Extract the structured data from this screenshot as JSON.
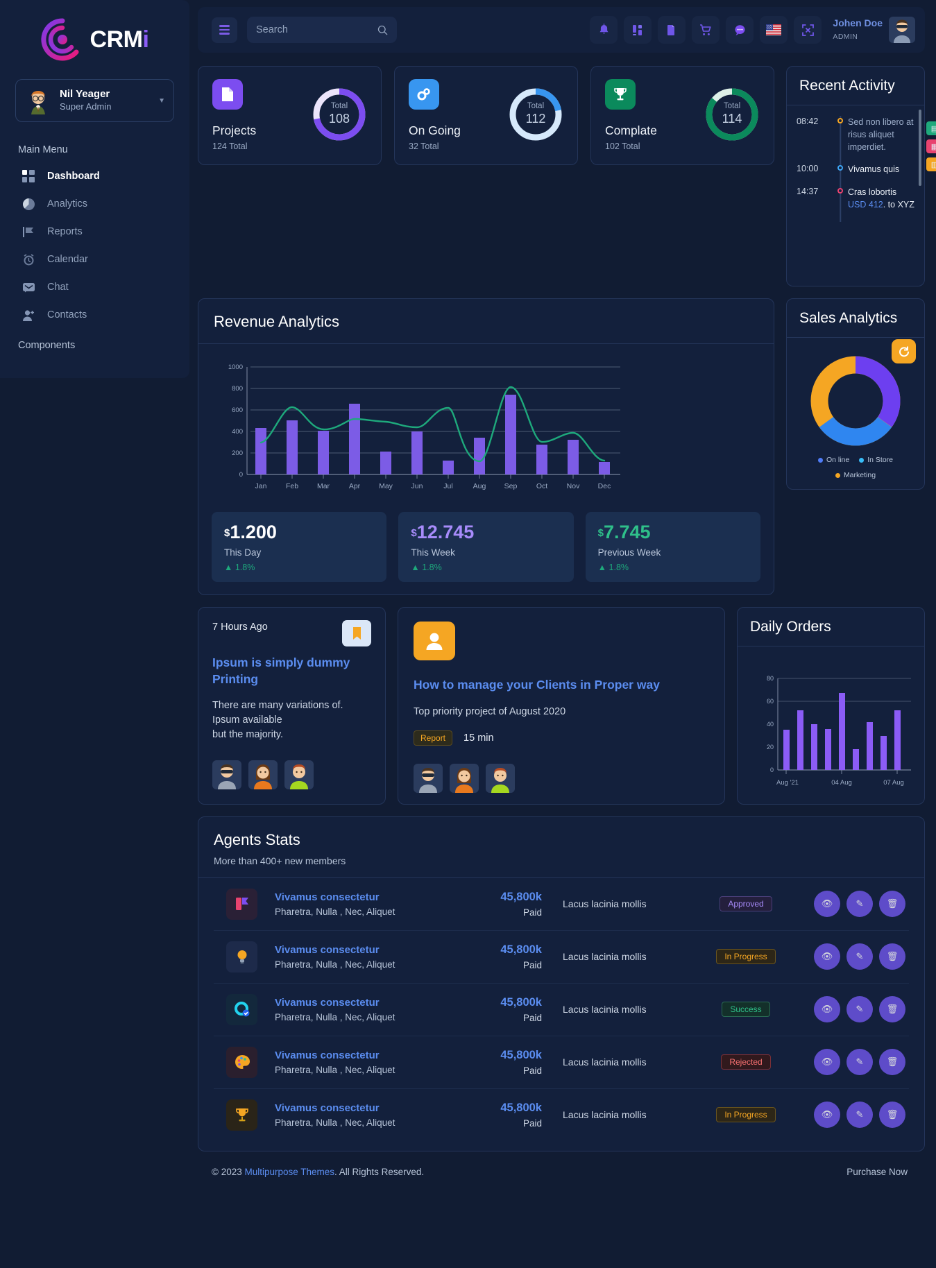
{
  "brand": {
    "name": "CRM",
    "accent_letter": "i",
    "logo_icon": "crm-spiral-logo"
  },
  "sidebar": {
    "profile": {
      "name": "Nil Yeager",
      "role": "Super Admin",
      "avatar_icon": "avatar-nil-yeager",
      "caret_icon": "chevron-down-icon"
    },
    "section_main": "Main Menu",
    "section_components": "Components",
    "items": [
      {
        "label": "Dashboard",
        "icon": "grid-icon",
        "active": true
      },
      {
        "label": "Analytics",
        "icon": "pie-chart-icon",
        "active": false
      },
      {
        "label": "Reports",
        "icon": "flag-icon",
        "active": false
      },
      {
        "label": "Calendar",
        "icon": "alarm-clock-icon",
        "active": false
      },
      {
        "label": "Chat",
        "icon": "chat-bubble-icon",
        "active": false
      },
      {
        "label": "Contacts",
        "icon": "user-plus-icon",
        "active": false
      }
    ]
  },
  "topbar": {
    "menu_toggle_icon": "hamburger-icon",
    "search": {
      "placeholder": "Search",
      "value": "",
      "icon": "search-icon"
    },
    "icons": [
      {
        "name": "bell-icon"
      },
      {
        "name": "widgets-icon"
      },
      {
        "name": "folder-icon"
      },
      {
        "name": "cart-icon"
      },
      {
        "name": "message-icon"
      },
      {
        "name": "flag-us-icon"
      },
      {
        "name": "fullscreen-icon"
      }
    ],
    "user": {
      "name": "Johen Doe",
      "role": "ADMIN",
      "avatar_icon": "avatar-johen-doe"
    }
  },
  "stat_cards": [
    {
      "title": "Projects",
      "subtitle": "124 Total",
      "total_label": "Total",
      "total_value": "108",
      "icon": "file-icon",
      "color": "#7c4df0",
      "track": "#ece5fb",
      "percent": 72
    },
    {
      "title": "On Going",
      "subtitle": "32 Total",
      "total_label": "Total",
      "total_value": "112",
      "icon": "gears-icon",
      "color": "#3896f0",
      "track": "#d6e9fb",
      "percent": 22
    },
    {
      "title": "Complate",
      "subtitle": "102 Total",
      "total_label": "Total",
      "total_value": "114",
      "icon": "trophy-icon",
      "color": "#0b8a5c",
      "track": "#def0e8",
      "percent": 86
    }
  ],
  "recent_activity": {
    "title": "Recent Activity",
    "items": [
      {
        "time": "08:42",
        "text": "Sed non libero at risus aliquet imperdiet.",
        "dot": "#f5a623"
      },
      {
        "time": "10:00",
        "text": "Vivamus quis",
        "dot": "#3ea6f5"
      },
      {
        "time": "14:37",
        "text_pre": "Cras lobortis ",
        "link": "USD 412",
        "text_post": ". to XYZ",
        "dot": "#e8436f"
      }
    ]
  },
  "side_tabs": [
    {
      "name": "green-tab",
      "color": "#1ea97c",
      "glyph": "▤"
    },
    {
      "name": "pink-tab",
      "color": "#e8436f",
      "glyph": "▦"
    },
    {
      "name": "yellow-tab",
      "color": "#f5a623",
      "glyph": "▥"
    }
  ],
  "revenue": {
    "title": "Revenue Analytics",
    "stats": [
      {
        "currency": "$",
        "amount": "1.200",
        "label": "This Day",
        "delta": "1.8%",
        "color": "#ffffff",
        "delta_color": "#1ea97c"
      },
      {
        "currency": "$",
        "amount": "12.745",
        "label": "This Week",
        "delta": "1.8%",
        "color": "#a78bfa",
        "delta_color": "#1ea97c"
      },
      {
        "currency": "$",
        "amount": "7.745",
        "label": "Previous Week",
        "delta": "1.8%",
        "color": "#2fc08a",
        "delta_color": "#1ea97c"
      }
    ]
  },
  "sales_analytics": {
    "title": "Sales Analytics",
    "button_icon": "refresh-icon",
    "legend": [
      {
        "label": "On line",
        "color": "#4f7cf7"
      },
      {
        "label": "In Store",
        "color": "#38bdf8"
      },
      {
        "label": "Marketing",
        "color": "#f5a623"
      }
    ]
  },
  "news_card": {
    "time": "7 Hours Ago",
    "badge_icon": "bookmark-icon",
    "title": "Ipsum is simply dummy Printing",
    "body_line1": "There are many variations of.",
    "body_line2": "Ipsum available",
    "body_line3": "but the majority.",
    "avatars": [
      "avatar-man-sunglasses",
      "avatar-woman-orange",
      "avatar-man-green"
    ]
  },
  "clients_card": {
    "icon": "user-icon",
    "title": "How to manage your Clients in Proper way",
    "body": "Top priority project of August 2020",
    "tag": "Report",
    "duration": "15 min",
    "avatars": [
      "avatar-man-sunglasses",
      "avatar-woman-orange",
      "avatar-man-green"
    ]
  },
  "daily_orders": {
    "title": "Daily Orders"
  },
  "agents": {
    "title": "Agents Stats",
    "subtitle": "More than 400+ new members",
    "rows": [
      {
        "icon": "chart-flag-icon",
        "icon_bg": "#2a2036",
        "name": "Vivamus consectetur",
        "detail": "Pharetra, Nulla , Nec, Aliquet",
        "amount": "45,800k",
        "amount_label": "Paid",
        "desc": "Lacus lacinia mollis",
        "status": "Approved",
        "status_color": "#a78bfa",
        "status_bg": "#241f3d",
        "status_border": "#4b3f7a"
      },
      {
        "icon": "bulb-icon",
        "icon_bg": "#1d2a4a",
        "name": "Vivamus consectetur",
        "detail": "Pharetra, Nulla , Nec, Aliquet",
        "amount": "45,800k",
        "amount_label": "Paid",
        "desc": "Lacus lacinia mollis",
        "status": "In Progress",
        "status_color": "#f5a623",
        "status_bg": "#2d2617",
        "status_border": "#6a551f"
      },
      {
        "icon": "gear-check-icon",
        "icon_bg": "#13283c",
        "name": "Vivamus consectetur",
        "detail": "Pharetra, Nulla , Nec, Aliquet",
        "amount": "45,800k",
        "amount_label": "Paid",
        "desc": "Lacus lacinia mollis",
        "status": "Success",
        "status_color": "#2fc08a",
        "status_bg": "#13302a",
        "status_border": "#2a6b53"
      },
      {
        "icon": "palette-icon",
        "icon_bg": "#2a1f2e",
        "name": "Vivamus consectetur",
        "detail": "Pharetra, Nulla , Nec, Aliquet",
        "amount": "45,800k",
        "amount_label": "Paid",
        "desc": "Lacus lacinia mollis",
        "status": "Rejected",
        "status_color": "#f87171",
        "status_bg": "#31191d",
        "status_border": "#7a3037"
      },
      {
        "icon": "trophy-gold-icon",
        "icon_bg": "#2a2418",
        "name": "Vivamus consectetur",
        "detail": "Pharetra, Nulla , Nec, Aliquet",
        "amount": "45,800k",
        "amount_label": "Paid",
        "desc": "Lacus lacinia mollis",
        "status": "In Progress",
        "status_color": "#f5a623",
        "status_bg": "#2d2617",
        "status_border": "#6a551f"
      }
    ],
    "action_icons": [
      "view-icon",
      "edit-icon",
      "delete-icon"
    ]
  },
  "footer": {
    "copyright_pre": "© 2023 ",
    "copyright_brand": "Multipurpose Themes",
    "copyright_post": ". All Rights Reserved.",
    "link": "Purchase Now"
  },
  "chart_data": [
    {
      "type": "bar",
      "id": "revenue-analytics",
      "title": "Revenue Analytics",
      "categories": [
        "Jan",
        "Feb",
        "Mar",
        "Apr",
        "May",
        "Jun",
        "Jul",
        "Aug",
        "Sep",
        "Oct",
        "Nov",
        "Dec"
      ],
      "series": [
        {
          "name": "Bars",
          "type": "bar",
          "color": "#7c5ce6",
          "values": [
            430,
            500,
            405,
            660,
            215,
            400,
            130,
            345,
            745,
            280,
            320,
            115
          ]
        },
        {
          "name": "Trend",
          "type": "line",
          "color": "#1ea97c",
          "values": [
            300,
            640,
            430,
            520,
            500,
            440,
            620,
            130,
            820,
            320,
            400,
            140
          ]
        }
      ],
      "ylabel": "",
      "xlabel": "",
      "ylim": [
        0,
        1000
      ],
      "yticks": [
        0,
        200,
        400,
        600,
        800,
        1000
      ],
      "grid": true,
      "legend": false
    },
    {
      "type": "pie",
      "id": "sales-analytics",
      "title": "Sales Analytics",
      "labels": [
        "On line",
        "In Store",
        "Marketing"
      ],
      "values": [
        35,
        30,
        35
      ],
      "colors": [
        "#4f7cf7",
        "#38bdf8",
        "#f5a623"
      ],
      "legend_position": "bottom",
      "donut": true
    },
    {
      "type": "bar",
      "id": "daily-orders",
      "title": "Daily Orders",
      "categories": [
        "Aug '21",
        "",
        "",
        "",
        "04 Aug",
        "",
        "",
        "07 Aug",
        ""
      ],
      "values": [
        35,
        52,
        40,
        36,
        67,
        18,
        42,
        30,
        52
      ],
      "tick_labels": [
        "Aug '21",
        "04 Aug",
        "07 Aug"
      ],
      "ylim": [
        0,
        80
      ],
      "yticks": [
        0,
        20,
        40,
        60,
        80
      ],
      "color": "#8b5cf6",
      "grid": false,
      "legend": false
    }
  ]
}
